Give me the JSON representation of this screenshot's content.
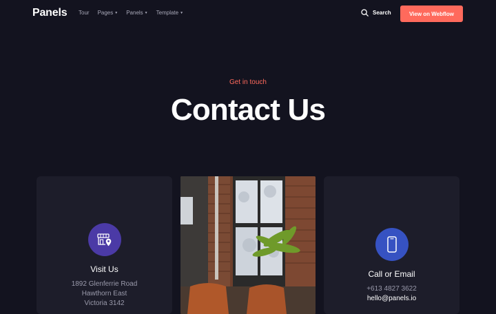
{
  "nav": {
    "logo": "Panels",
    "links": [
      {
        "label": "Tour",
        "dropdown": false
      },
      {
        "label": "Pages",
        "dropdown": true
      },
      {
        "label": "Panels",
        "dropdown": true
      },
      {
        "label": "Template",
        "dropdown": true
      }
    ],
    "search_label": "Search",
    "cta_label": "View on Webflow"
  },
  "hero": {
    "eyebrow": "Get in touch",
    "title": "Contact Us"
  },
  "cards": {
    "visit": {
      "icon": "store-location-icon",
      "title": "Visit Us",
      "lines": [
        "1892 Glenferrie Road",
        "Hawthorn East",
        "Victoria 3142"
      ]
    },
    "call": {
      "icon": "phone-icon",
      "title": "Call or Email",
      "phone": "+613 4827 3622",
      "email": "hello@panels.io"
    }
  },
  "colors": {
    "background": "#13131f",
    "card": "#1d1d2a",
    "accent": "#ff6a5c",
    "visit_icon_bg": "#4b3aa6",
    "call_icon_bg": "#3652c2"
  }
}
